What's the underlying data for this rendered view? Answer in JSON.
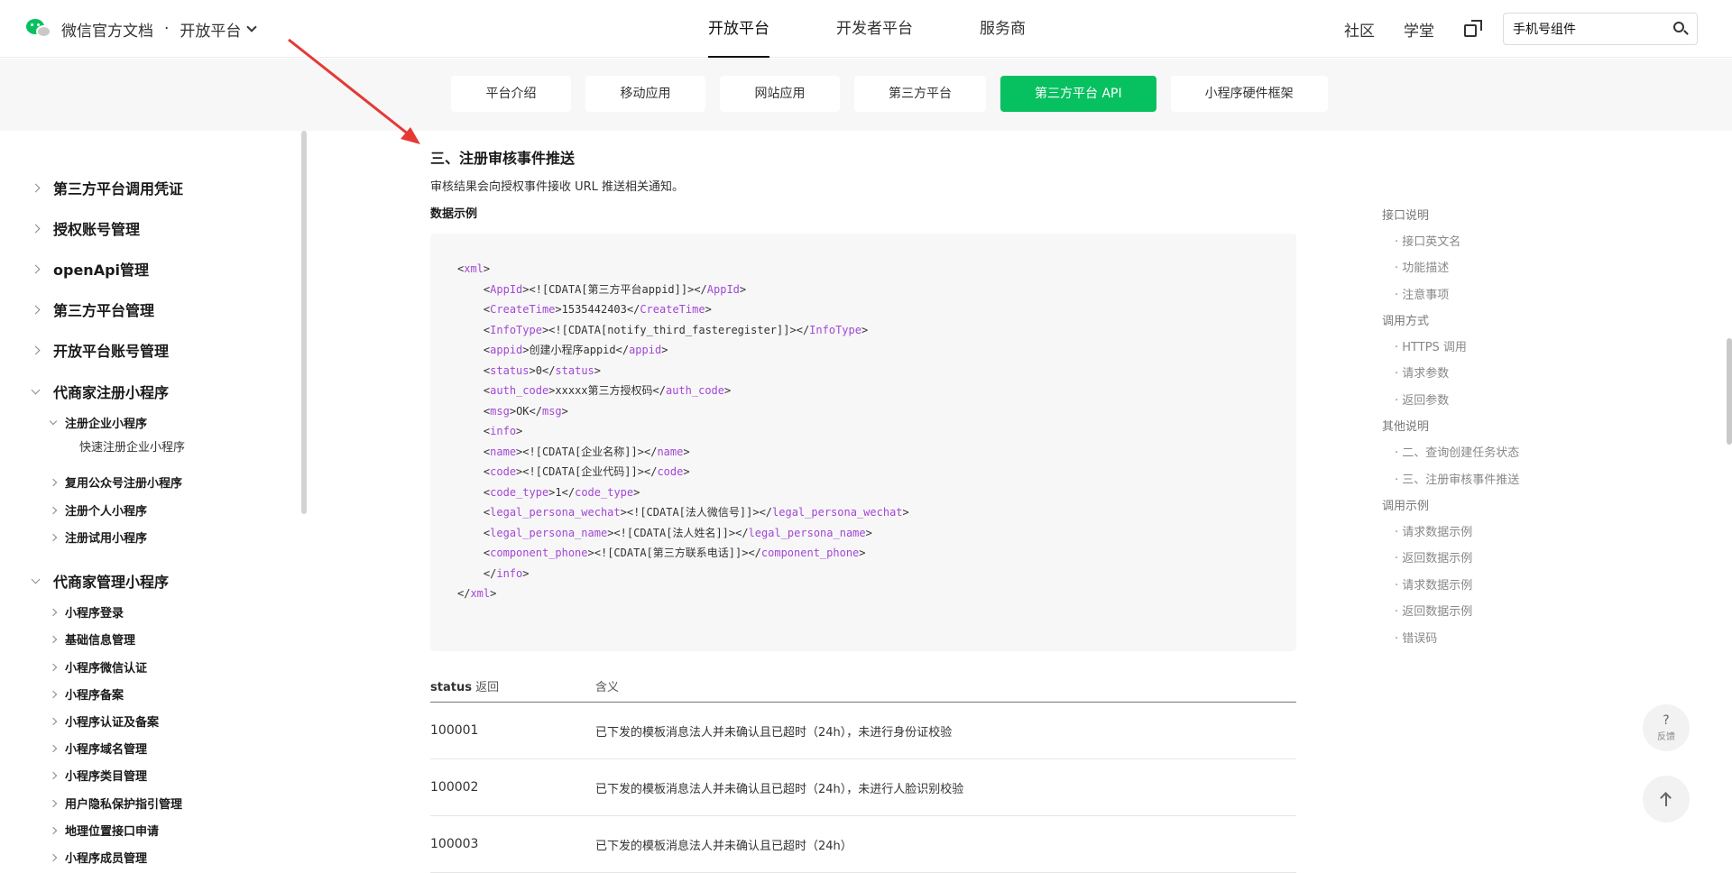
{
  "header": {
    "brand_title": "微信官方文档",
    "brand_sep": "·",
    "brand_section": "开放平台",
    "nav": [
      "开放平台",
      "开发者平台",
      "服务商"
    ],
    "right_links": [
      "社区",
      "学堂"
    ],
    "search_value": "手机号组件"
  },
  "subtabs": [
    "平台介绍",
    "移动应用",
    "网站应用",
    "第三方平台",
    "第三方平台 API",
    "小程序硬件框架"
  ],
  "sidebar": {
    "l1_a": [
      "第三方平台调用凭证",
      "授权账号管理",
      "openApi管理",
      "第三方平台管理",
      "开放平台账号管理"
    ],
    "group1": "代商家注册小程序",
    "group1_sub_open": "注册企业小程序",
    "group1_leaf": "快速注册企业小程序",
    "group1_subs": [
      "复用公众号注册小程序",
      "注册个人小程序",
      "注册试用小程序"
    ],
    "group2": "代商家管理小程序",
    "group2_subs": [
      "小程序登录",
      "基础信息管理",
      "小程序微信认证",
      "小程序备案",
      "小程序认证及备案",
      "小程序域名管理",
      "小程序类目管理",
      "用户隐私保护指引管理",
      "地理位置接口申请",
      "小程序成员管理"
    ]
  },
  "content": {
    "heading": "三、注册审核事件推送",
    "desc": "审核结果会向授权事件接收 URL 推送相关通知。",
    "example_label": "数据示例",
    "code_lines": [
      [
        "",
        "<",
        "xml",
        ">",
        "",
        "",
        "",
        ""
      ],
      [
        "    ",
        "<",
        "AppId",
        ">",
        "<![CDATA[第三方平台appid]]>",
        "</",
        "AppId",
        ">"
      ],
      [
        "    ",
        "<",
        "CreateTime",
        ">",
        "1535442403",
        "</",
        "CreateTime",
        ">"
      ],
      [
        "    ",
        "<",
        "InfoType",
        ">",
        "<![CDATA[notify_third_fasteregister]]>",
        "</",
        "InfoType",
        ">"
      ],
      [
        "    ",
        "<",
        "appid",
        ">",
        "创建小程序appid",
        "</",
        "appid",
        ">"
      ],
      [
        "    ",
        "<",
        "status",
        ">",
        "0",
        "</",
        "status",
        ">"
      ],
      [
        "    ",
        "<",
        "auth_code",
        ">",
        "xxxxx第三方授权码",
        "</",
        "auth_code",
        ">"
      ],
      [
        "    ",
        "<",
        "msg",
        ">",
        "OK",
        "</",
        "msg",
        ">"
      ],
      [
        "    ",
        "<",
        "info",
        ">",
        "",
        "",
        "",
        ""
      ],
      [
        "    ",
        "<",
        "name",
        ">",
        "<![CDATA[企业名称]]>",
        "</",
        "name",
        ">"
      ],
      [
        "    ",
        "<",
        "code",
        ">",
        "<![CDATA[企业代码]]>",
        "</",
        "code",
        ">"
      ],
      [
        "    ",
        "<",
        "code_type",
        ">",
        "1",
        "</",
        "code_type",
        ">"
      ],
      [
        "    ",
        "<",
        "legal_persona_wechat",
        ">",
        "<![CDATA[法人微信号]]>",
        "</",
        "legal_persona_wechat",
        ">"
      ],
      [
        "    ",
        "<",
        "legal_persona_name",
        ">",
        "<![CDATA[法人姓名]]>",
        "</",
        "legal_persona_name",
        ">"
      ],
      [
        "    ",
        "<",
        "component_phone",
        ">",
        "<![CDATA[第三方联系电话]]>",
        "</",
        "component_phone",
        ">"
      ],
      [
        "    ",
        "</",
        "info",
        ">",
        "",
        "",
        "",
        ""
      ],
      [
        "",
        "</",
        "xml",
        ">",
        "",
        "",
        "",
        ""
      ]
    ],
    "table": {
      "head_code": "status",
      "head_code_suffix": " 返回",
      "head_meaning": "含义",
      "rows": [
        [
          "100001",
          "已下发的模板消息法人并未确认且已超时（24h），未进行身份证校验"
        ],
        [
          "100002",
          "已下发的模板消息法人并未确认且已超时（24h），未进行人脸识别校验"
        ],
        [
          "100003",
          "已下发的模板消息法人并未确认且已超时（24h）"
        ]
      ]
    }
  },
  "toc": [
    {
      "text": "接口说明",
      "sub": false
    },
    {
      "text": "· 接口英文名",
      "sub": true
    },
    {
      "text": "· 功能描述",
      "sub": true
    },
    {
      "text": "· 注意事项",
      "sub": true
    },
    {
      "text": "调用方式",
      "sub": false
    },
    {
      "text": "· HTTPS 调用",
      "sub": true
    },
    {
      "text": "· 请求参数",
      "sub": true
    },
    {
      "text": "· 返回参数",
      "sub": true
    },
    {
      "text": "其他说明",
      "sub": false
    },
    {
      "text": "· 二、查询创建任务状态",
      "sub": true
    },
    {
      "text": "· 三、注册审核事件推送",
      "sub": true
    },
    {
      "text": "调用示例",
      "sub": false
    },
    {
      "text": "· 请求数据示例",
      "sub": true
    },
    {
      "text": "· 返回数据示例",
      "sub": true
    },
    {
      "text": "· 请求数据示例",
      "sub": true
    },
    {
      "text": "· 返回数据示例",
      "sub": true
    },
    {
      "text": "· 错误码",
      "sub": true
    }
  ],
  "feedback": {
    "symbol": "?",
    "label": "反馈"
  },
  "colors": {
    "accent": "#07c160",
    "tag": "#a247d6",
    "annotation_arrow": "#e53935"
  }
}
